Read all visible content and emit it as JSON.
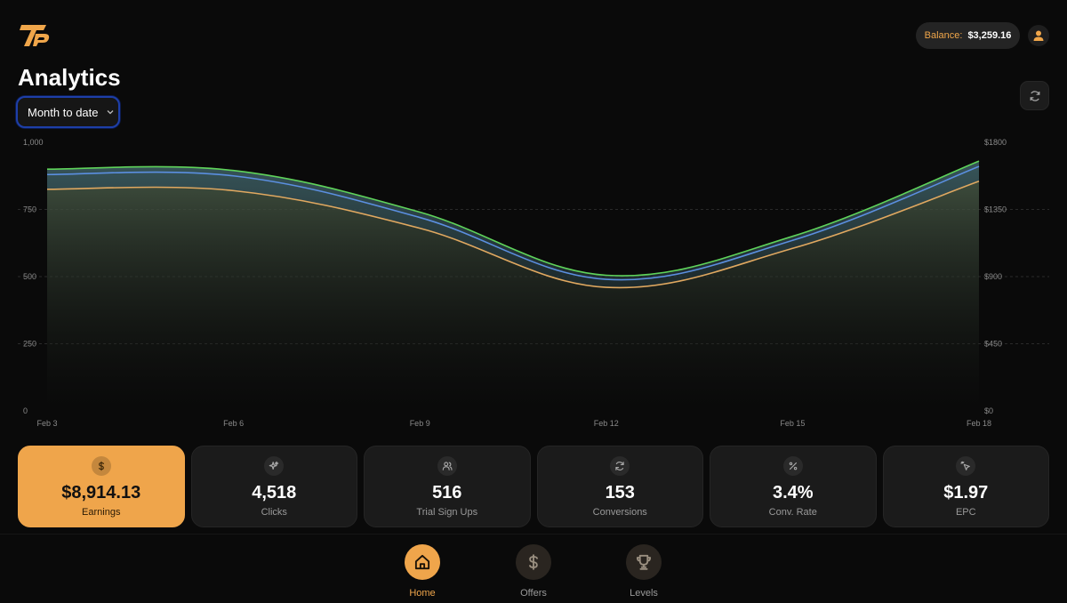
{
  "header": {
    "balance_label": "Balance:",
    "balance_value": "$3,259.16"
  },
  "page": {
    "title": "Analytics",
    "range_select_value": "Month to date"
  },
  "colors": {
    "accent": "#efa54b",
    "series_green": "#5fd35a",
    "series_blue": "#5b8fe0",
    "series_orange": "#e0a860"
  },
  "chart_data": {
    "type": "area",
    "x": [
      "Feb 3",
      "Feb 6",
      "Feb 9",
      "Feb 12",
      "Feb 15",
      "Feb 18"
    ],
    "y_left_ticks": [
      "1,000",
      "750",
      "500",
      "250",
      "0"
    ],
    "y_right_ticks": [
      "$1800",
      "$1350",
      "$900",
      "$450",
      "$0"
    ],
    "ylim_left": [
      0,
      1000
    ],
    "ylim_right": [
      0,
      1800
    ],
    "series": [
      {
        "color": "#5fd35a",
        "values": [
          900,
          895,
          740,
          505,
          650,
          930
        ]
      },
      {
        "color": "#5b8fe0",
        "values": [
          880,
          875,
          720,
          490,
          635,
          910
        ]
      },
      {
        "color": "#e0a860",
        "values": [
          825,
          820,
          680,
          460,
          605,
          855
        ]
      }
    ],
    "grid": "dashed-horizontal",
    "legend": "none"
  },
  "stats": [
    {
      "icon": "dollar-icon",
      "value": "$8,914.13",
      "label": "Earnings",
      "active": true
    },
    {
      "icon": "sparkle-icon",
      "value": "4,518",
      "label": "Clicks",
      "active": false
    },
    {
      "icon": "users-icon",
      "value": "516",
      "label": "Trial Sign Ups",
      "active": false
    },
    {
      "icon": "refresh-icon",
      "value": "153",
      "label": "Conversions",
      "active": false
    },
    {
      "icon": "percent-icon",
      "value": "3.4%",
      "label": "Conv. Rate",
      "active": false
    },
    {
      "icon": "pointer-icon",
      "value": "$1.97",
      "label": "EPC",
      "active": false
    }
  ],
  "nav": [
    {
      "icon": "home-icon",
      "label": "Home",
      "active": true
    },
    {
      "icon": "dollar-icon",
      "label": "Offers",
      "active": false
    },
    {
      "icon": "trophy-icon",
      "label": "Levels",
      "active": false
    }
  ]
}
